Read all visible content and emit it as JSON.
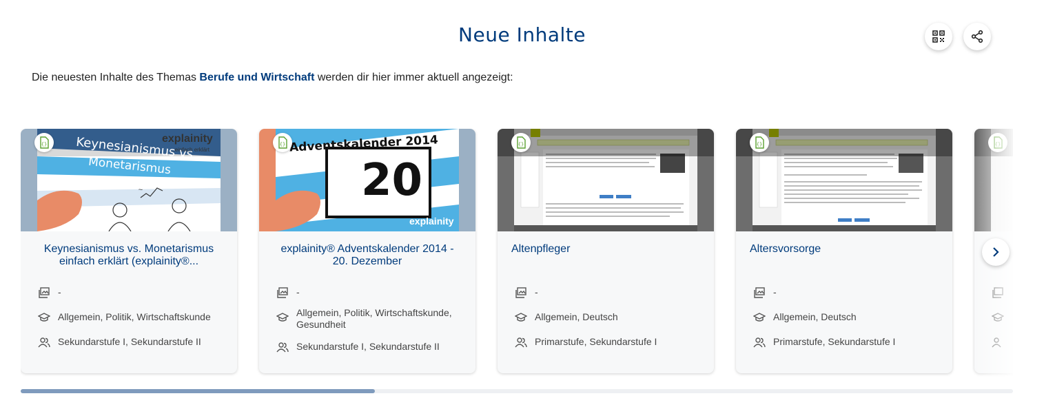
{
  "header": {
    "title": "Neue Inhalte",
    "qr_icon": "qr-code-icon",
    "share_icon": "share-icon"
  },
  "intro": {
    "prefix": "Die neuesten Inhalte des Themas ",
    "topic": "Berufe und Wirtschaft",
    "suffix": " werden dir hier immer aktuell angezeigt:"
  },
  "cards": [
    {
      "title": "Keynesianismus vs. Monetarismus einfach erklärt (explainity®...",
      "thumb_text_1": "Keynesianismus vs.",
      "thumb_text_2": "Monetarismus",
      "thumb_brand": "explainity",
      "thumb_tagline": "...einfach erklärt",
      "collection": "-",
      "subjects": "Allgemein, Politik, Wirtschaftskunde",
      "levels": "Sekundarstufe I, Sekundarstufe II"
    },
    {
      "title": "explainity® Adventskalender 2014 - 20. Dezember",
      "thumb_text_1": "Adventskalender 2014",
      "thumb_text_2": "20",
      "thumb_brand": "explainity",
      "collection": "-",
      "subjects": "Allgemein, Politik, Wirtschaftskunde, Gesundheit",
      "levels": "Sekundarstufe I, Sekundarstufe II"
    },
    {
      "title": "Altenpfleger",
      "collection": "-",
      "subjects": "Allgemein, Deutsch",
      "levels": "Primarstufe, Sekundarstufe I"
    },
    {
      "title": "Altersvorsorge",
      "collection": "-",
      "subjects": "Allgemein, Deutsch",
      "levels": "Primarstufe, Sekundarstufe I"
    }
  ],
  "icons": {
    "type": "file-code-icon",
    "collection": "collection-icon",
    "subjects": "graduation-cap-icon",
    "levels": "people-icon",
    "next": "chevron-right-icon"
  },
  "colors": {
    "brand": "#003b7c",
    "badge": "#5aa130",
    "scrollbar": "#7f9bbd"
  },
  "scroll": {
    "position_fraction": 0.357
  }
}
